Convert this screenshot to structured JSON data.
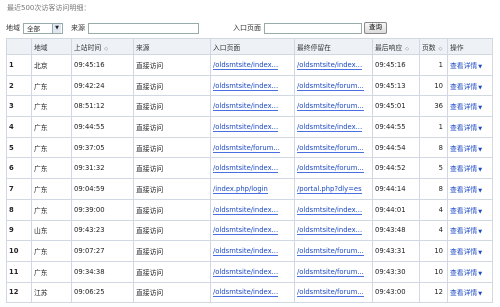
{
  "title": "最近500次访客访问明细：",
  "filter": {
    "region_label": "地域",
    "region_value": "全部",
    "source_label": "来源",
    "entry_label": "入口页面",
    "query_button": "查询"
  },
  "columns": [
    {
      "label": "",
      "sort": false
    },
    {
      "label": "地域",
      "sort": false
    },
    {
      "label": "上站时间",
      "sort": true
    },
    {
      "label": "来源",
      "sort": false
    },
    {
      "label": "入口页面",
      "sort": false
    },
    {
      "label": "最终停留在",
      "sort": false
    },
    {
      "label": "最后响应",
      "sort": true
    },
    {
      "label": "页数",
      "sort": true
    },
    {
      "label": "操作",
      "sort": false
    }
  ],
  "op_label": "查看详情",
  "rows": [
    [
      "1",
      "北京",
      "09:45:16",
      "直接访问",
      "/oldsmtsite/index...",
      "/oldsmtsite/index...",
      "09:45:16",
      "1"
    ],
    [
      "2",
      "广东",
      "09:42:24",
      "直接访问",
      "/oldsmtsite/index...",
      "/oldsmtsite/forum...",
      "09:45:13",
      "10"
    ],
    [
      "3",
      "广东",
      "08:51:12",
      "直接访问",
      "/oldsmtsite/index...",
      "/oldsmtsite/forum...",
      "09:45:01",
      "36"
    ],
    [
      "4",
      "广东",
      "09:44:55",
      "直接访问",
      "/oldsmtsite/index...",
      "/oldsmtsite/index...",
      "09:44:55",
      "1"
    ],
    [
      "5",
      "广东",
      "09:37:05",
      "直接访问",
      "/oldsmtsite/forum...",
      "/oldsmtsite/forum...",
      "09:44:54",
      "8"
    ],
    [
      "6",
      "广东",
      "09:31:32",
      "直接访问",
      "/oldsmtsite/index...",
      "/oldsmtsite/forum...",
      "09:44:52",
      "5"
    ],
    [
      "7",
      "广东",
      "09:04:59",
      "直接访问",
      "/index.php/login",
      "/portal.php?dly=es",
      "09:44:14",
      "8"
    ],
    [
      "8",
      "广东",
      "09:39:00",
      "直接访问",
      "/oldsmtsite/index...",
      "/oldsmtsite/index...",
      "09:44:01",
      "4"
    ],
    [
      "9",
      "山东",
      "09:43:23",
      "直接访问",
      "/oldsmtsite/index...",
      "/oldsmtsite/index...",
      "09:43:48",
      "4"
    ],
    [
      "10",
      "广东",
      "09:07:27",
      "直接访问",
      "/oldsmtsite/index...",
      "/oldsmtsite/forum...",
      "09:43:31",
      "10"
    ],
    [
      "11",
      "广东",
      "09:34:38",
      "直接访问",
      "/oldsmtsite/index...",
      "/oldsmtsite/forum...",
      "09:43:30",
      "10"
    ],
    [
      "12",
      "江苏",
      "09:06:25",
      "直接访问",
      "/oldsmtsite/index...",
      "/oldsmtsite/forum...",
      "09:43:00",
      "12"
    ]
  ]
}
